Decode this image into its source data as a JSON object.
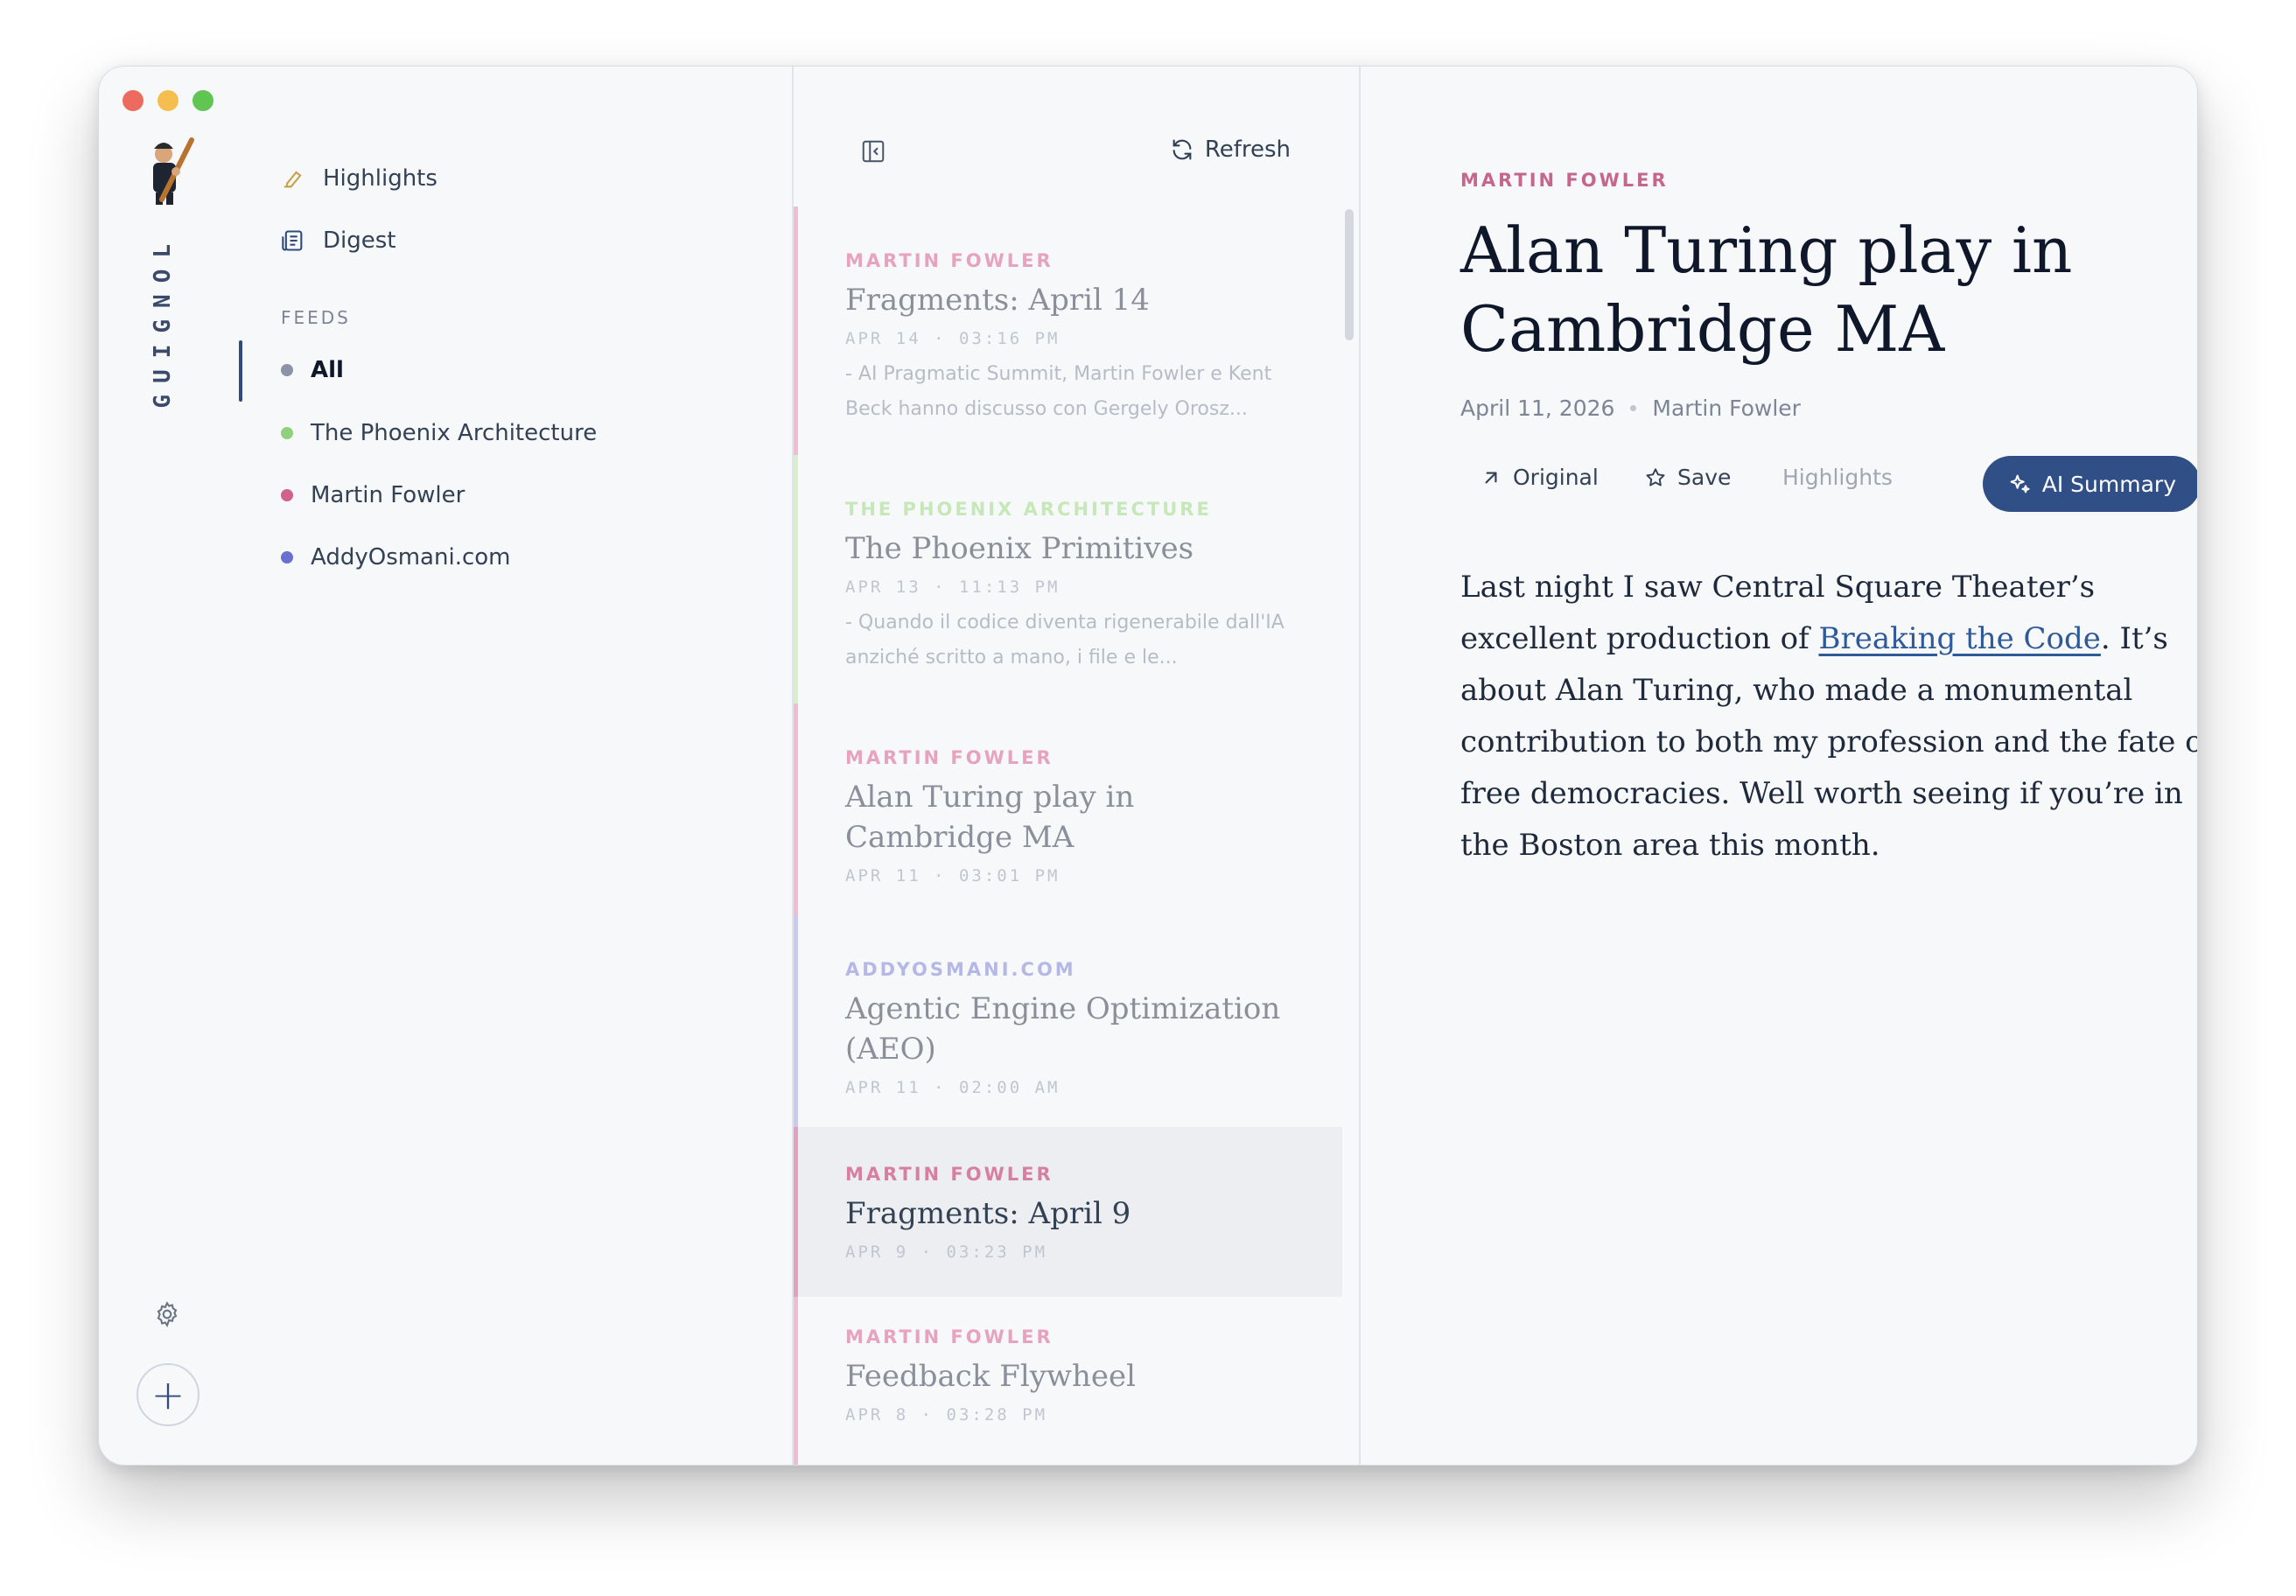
{
  "app": {
    "brand": "GUIGNOL"
  },
  "nav": {
    "highlights": "Highlights",
    "digest": "Digest",
    "feeds_heading": "FEEDS",
    "feeds": [
      {
        "label": "All",
        "color": "#8a94a6",
        "active": true
      },
      {
        "label": "The Phoenix Architecture",
        "color": "#8fd17a"
      },
      {
        "label": "Martin Fowler",
        "color": "#d0638b"
      },
      {
        "label": "AddyOsmani.com",
        "color": "#6a6fd0"
      }
    ]
  },
  "list": {
    "refresh_label": "Refresh",
    "items": [
      {
        "source": "MARTIN FOWLER",
        "source_color": "#e7a3bd",
        "bar_color": "#f0bccf",
        "title": "Fragments: April 14",
        "date": "APR 14",
        "time": "03:16 PM",
        "excerpt": "- AI Pragmatic Summit, Martin Fowler e Kent Beck hanno discusso con Gergely Orosz..."
      },
      {
        "source": "THE PHOENIX ARCHITECTURE",
        "source_color": "#c6e8b8",
        "bar_color": "#d6efc9",
        "title": "The Phoenix Primitives",
        "date": "APR 13",
        "time": "11:13 PM",
        "excerpt": "- Quando il codice diventa rigenerabile dall'IA anziché scritto a mano, i file e le..."
      },
      {
        "source": "MARTIN FOWLER",
        "source_color": "#e7a3bd",
        "bar_color": "#f0bccf",
        "title": "Alan Turing play in Cambridge MA",
        "date": "APR 11",
        "time": "03:01 PM"
      },
      {
        "source": "ADDYOSMANI.COM",
        "source_color": "#b5b8e6",
        "bar_color": "#c8caf0",
        "title": "Agentic Engine Optimization (AEO)",
        "date": "APR 11",
        "time": "02:00 AM"
      },
      {
        "source": "MARTIN FOWLER",
        "source_color": "#d77fa1",
        "bar_color": "#e2a0bb",
        "title": "Fragments: April 9",
        "date": "APR 9",
        "time": "03:23 PM"
      },
      {
        "source": "MARTIN FOWLER",
        "source_color": "#e7a3bd",
        "bar_color": "#f0bccf",
        "title": "Feedback Flywheel",
        "date": "APR 8",
        "time": "03:28 PM"
      }
    ]
  },
  "reader": {
    "source": "MARTIN FOWLER",
    "title": "Alan Turing play in Cambridge MA",
    "date": "April 11, 2026",
    "author": "Martin Fowler",
    "actions": {
      "original": "Original",
      "save": "Save",
      "highlights": "Highlights",
      "ai_summary": "AI Summary"
    },
    "body": {
      "before_link": "Last night I saw Central Square Theater’s excellent production of ",
      "link_text": "Breaking the Code",
      "after_link": ". It’s about Alan Turing, who made a monumental contribution to both my profession and the fate of free democracies. Well worth seeing if you’re in the Boston area this month."
    }
  },
  "colors": {
    "accent": "#2f4f86",
    "window_bg": "#f7f8fa"
  }
}
